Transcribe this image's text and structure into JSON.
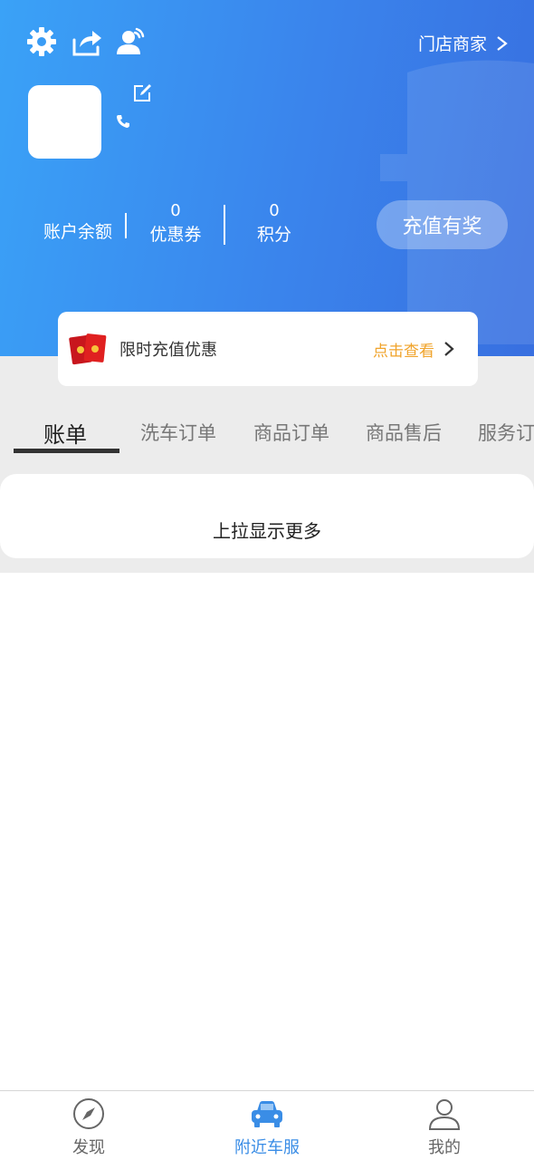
{
  "header": {
    "store_link": "门店商家",
    "stats": {
      "balance_label": "账户余额",
      "coupon_value": "0",
      "coupon_label": "优惠券",
      "points_value": "0",
      "points_label": "积分"
    },
    "recharge_button": "充值有奖"
  },
  "promo": {
    "text": "限时充值优惠",
    "link": "点击查看"
  },
  "tabs": [
    "账单",
    "洗车订单",
    "商品订单",
    "商品售后",
    "服务订单"
  ],
  "list": {
    "load_more": "上拉显示更多"
  },
  "bottom_nav": {
    "items": [
      {
        "label": "发现",
        "icon": "compass-icon"
      },
      {
        "label": "附近车服",
        "icon": "car-icon"
      },
      {
        "label": "我的",
        "icon": "user-icon"
      }
    ]
  },
  "colors": {
    "header_start": "#3aa2f7",
    "header_end": "#386fe0",
    "promo_link": "#f0a32a",
    "nav_active": "#3a8de6"
  }
}
